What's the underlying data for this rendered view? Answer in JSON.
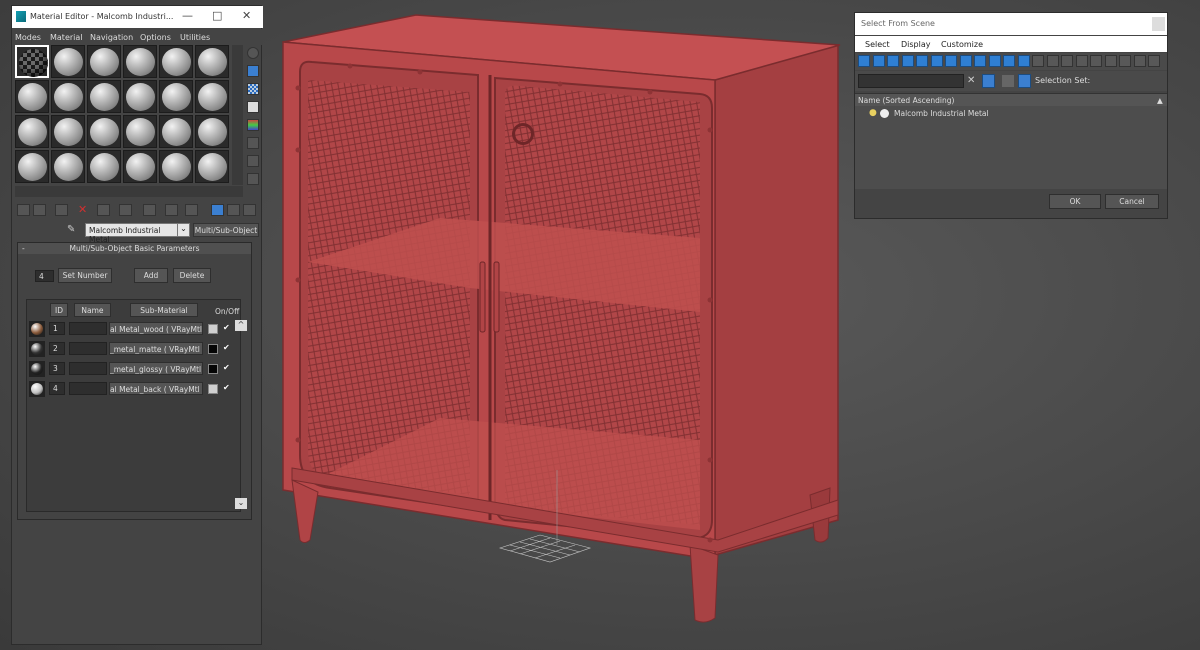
{
  "material_editor": {
    "title": "Material Editor - Malcomb Industri...",
    "window_controls": [
      "—",
      "□",
      "✕"
    ],
    "menu": [
      "Modes",
      "Material",
      "Navigation",
      "Options",
      "Utilities"
    ],
    "material_name": "Malcomb Industrial Metal",
    "material_type": "Multi/Sub-Object",
    "rollout_title": "Multi/Sub-Object Basic Parameters",
    "rollout_collapse": "-",
    "count_value": "4",
    "set_number_label": "Set Number",
    "add_label": "Add",
    "delete_label": "Delete",
    "col_id": "ID",
    "col_name": "Name",
    "col_sub": "Sub-Material",
    "col_onoff": "On/Off",
    "sub_materials": [
      {
        "id": "1",
        "name": "",
        "sub": "al Metal_wood  ( VRayMtl )",
        "swatch": "#d0d0d0",
        "on": "✔",
        "thumb": "#8a5a3a"
      },
      {
        "id": "2",
        "name": "",
        "sub": "_metal_matte  ( VRayMtl )",
        "swatch": "#050505",
        "on": "✔",
        "thumb": "#333333"
      },
      {
        "id": "3",
        "name": "",
        "sub": "_metal_glossy  ( VRayMtl )",
        "swatch": "#050505",
        "on": "✔",
        "thumb": "#222222"
      },
      {
        "id": "4",
        "name": "",
        "sub": "al Metal_back  ( VRayMtl )",
        "swatch": "#d0d0d0",
        "on": "✔",
        "thumb": "#c0c0c0"
      }
    ]
  },
  "select_from_scene": {
    "title": "Select From Scene",
    "menu": [
      "Select",
      "Display",
      "Customize"
    ],
    "selection_set_label": "Selection Set:",
    "column_header": "Name (Sorted Ascending)",
    "sort_arrow": "▲",
    "items": [
      "Malcomb Industrial Metal"
    ],
    "ok_label": "OK",
    "cancel_label": "Cancel",
    "clear_glyph": "✕"
  },
  "scene": {
    "object_color": "#b8484a",
    "object_name": "Malcomb Industrial Metal"
  }
}
